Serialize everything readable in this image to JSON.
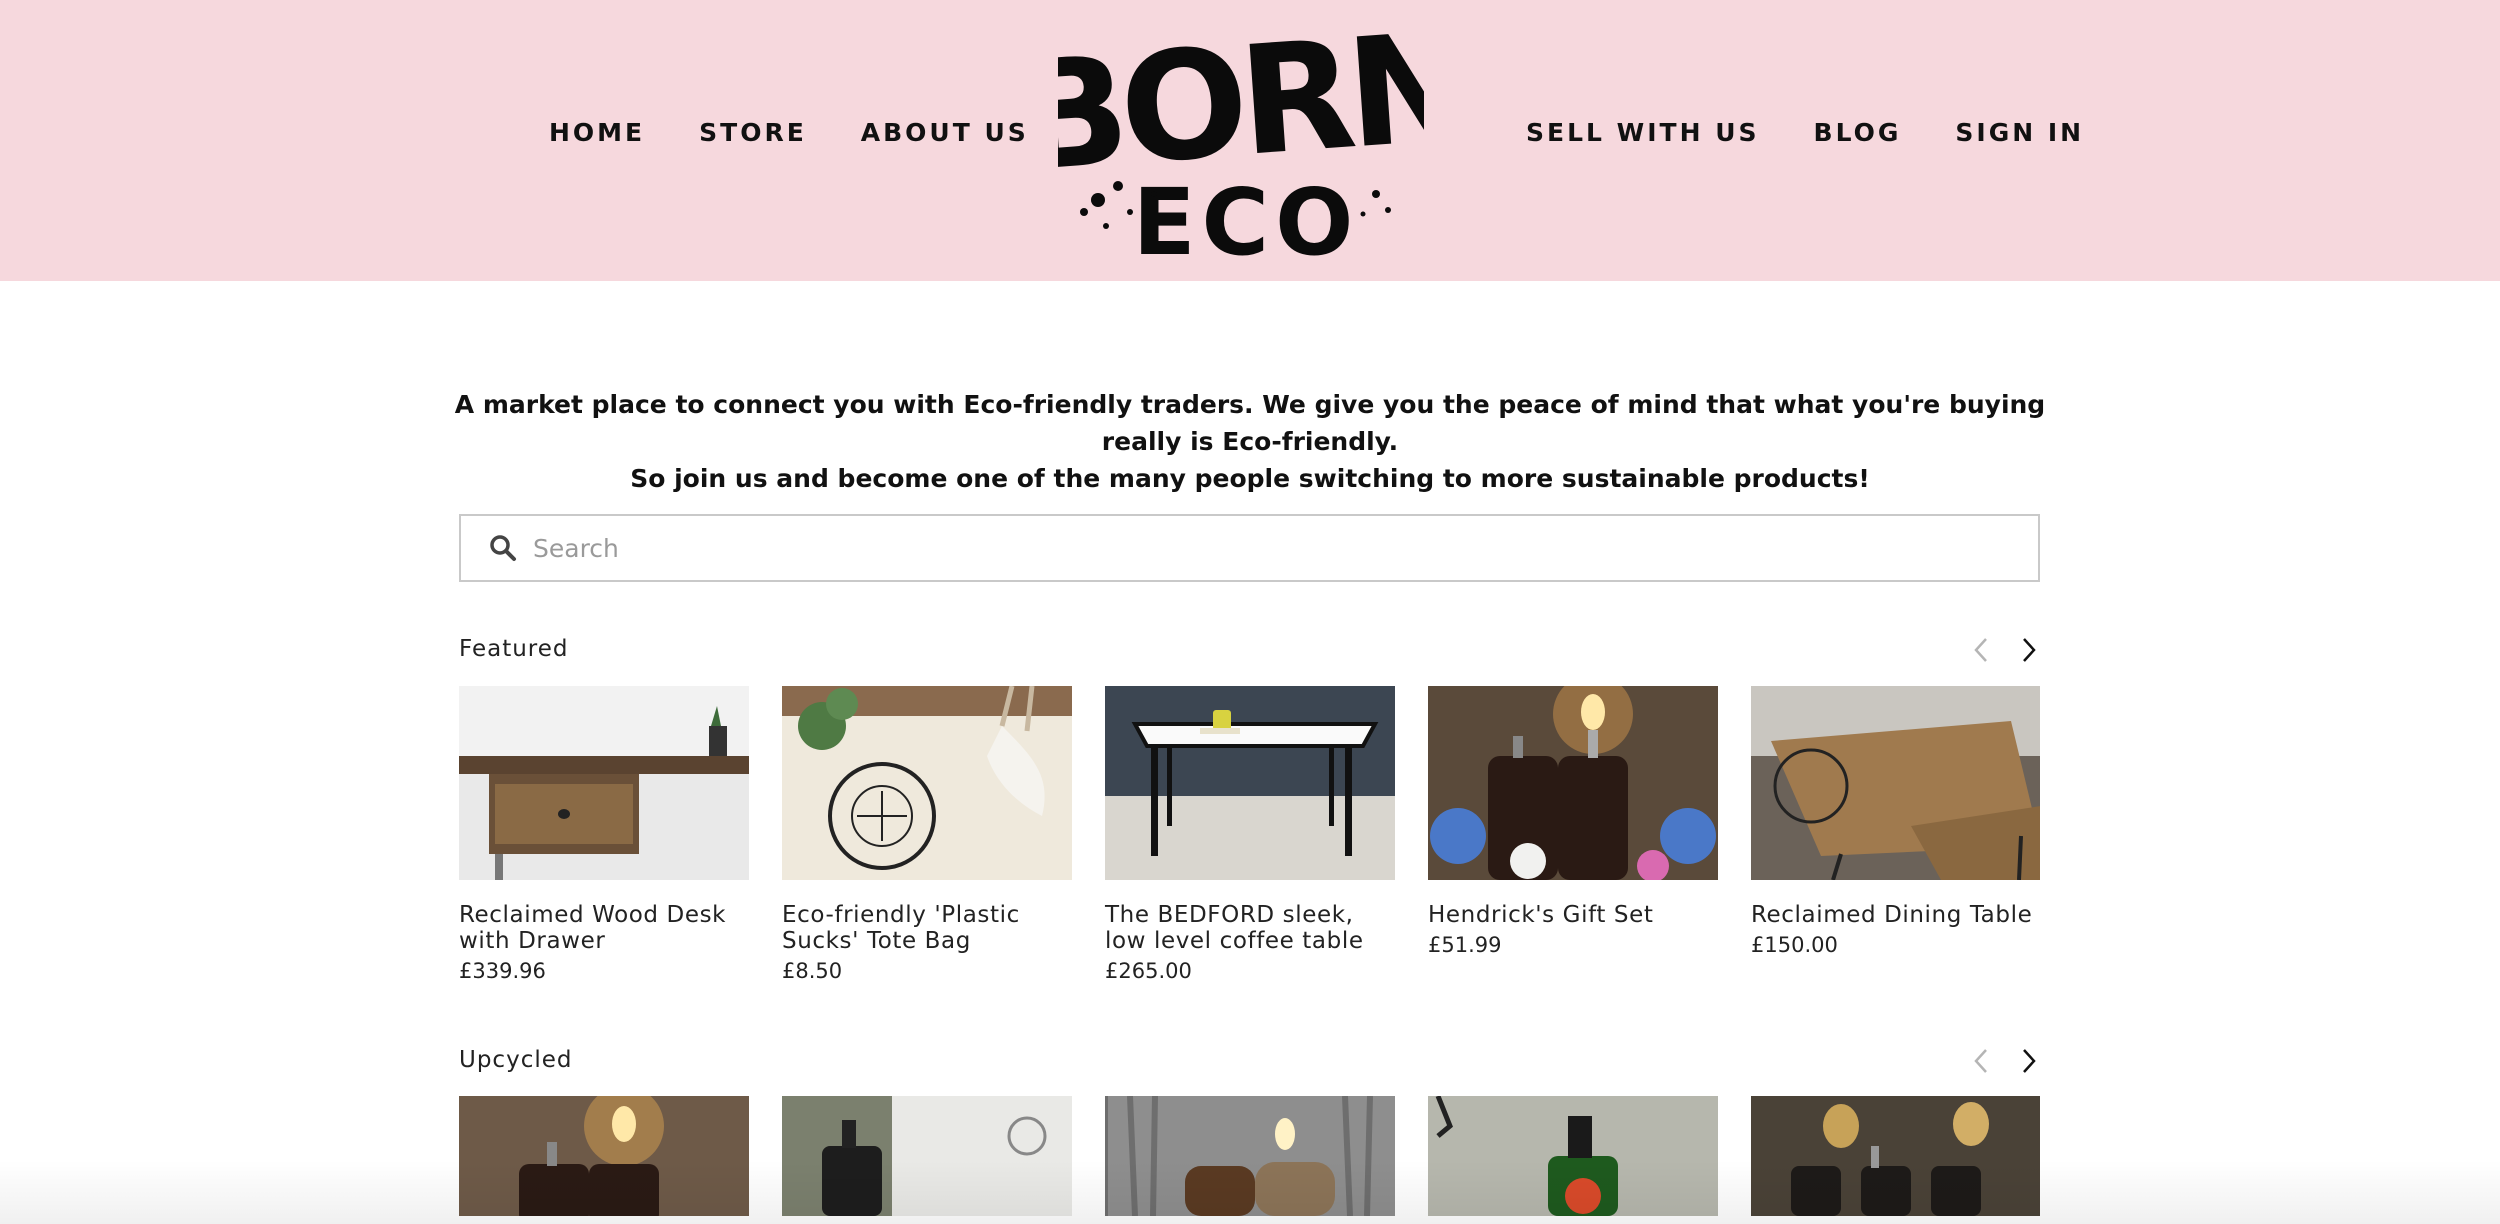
{
  "header": {
    "nav_left": [
      "HOME",
      "STORE",
      "ABOUT US"
    ],
    "nav_right": [
      "SELL WITH US",
      "BLOG",
      "SIGN IN"
    ],
    "logo_line1": "BORN",
    "logo_line2": "ECO",
    "background_color": "#f6d8dd"
  },
  "intro": {
    "line1": "A market place to connect you with Eco-friendly traders. We give you the peace of mind that what you're buying really is Eco-friendly.",
    "line2": "So join us and become one of the many people switching to more sustainable products!"
  },
  "search": {
    "placeholder": "Search",
    "icon": "search-icon"
  },
  "featured": {
    "title": "Featured",
    "products": [
      {
        "name": "Reclaimed Wood Desk with Drawer",
        "price": "£339.96"
      },
      {
        "name": "Eco-friendly 'Plastic Sucks' Tote Bag",
        "price": "£8.50"
      },
      {
        "name": "The BEDFORD sleek, low level coffee table",
        "price": "£265.00"
      },
      {
        "name": "Hendrick's Gift Set",
        "price": "£51.99"
      },
      {
        "name": "Reclaimed Dining Table",
        "price": "£150.00"
      }
    ]
  },
  "upcycled": {
    "title": "Upcycled"
  }
}
